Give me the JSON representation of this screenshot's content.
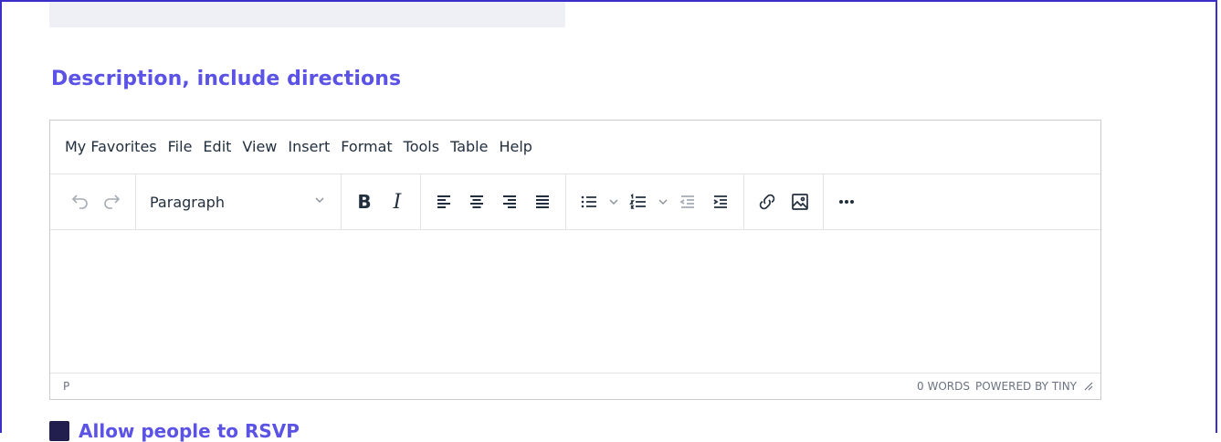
{
  "section": {
    "title": "Description, include directions"
  },
  "editor": {
    "menu": [
      "My Favorites",
      "File",
      "Edit",
      "View",
      "Insert",
      "Format",
      "Tools",
      "Table",
      "Help"
    ],
    "block_format": "Paragraph",
    "status": {
      "path": "P",
      "word_count": "0 WORDS",
      "branding": "POWERED BY TINY"
    }
  },
  "rsvp": {
    "label": "Allow people to RSVP"
  },
  "colors": {
    "accent": "#5b52e6",
    "frame": "#3b2fc9",
    "checkbox": "#221e4d"
  },
  "icons": [
    "undo-icon",
    "redo-icon",
    "bold-icon",
    "italic-icon",
    "align-left-icon",
    "align-center-icon",
    "align-right-icon",
    "align-justify-icon",
    "bullet-list-icon",
    "numbered-list-icon",
    "outdent-icon",
    "indent-icon",
    "link-icon",
    "image-icon",
    "more-icon",
    "resize-handle-icon"
  ]
}
